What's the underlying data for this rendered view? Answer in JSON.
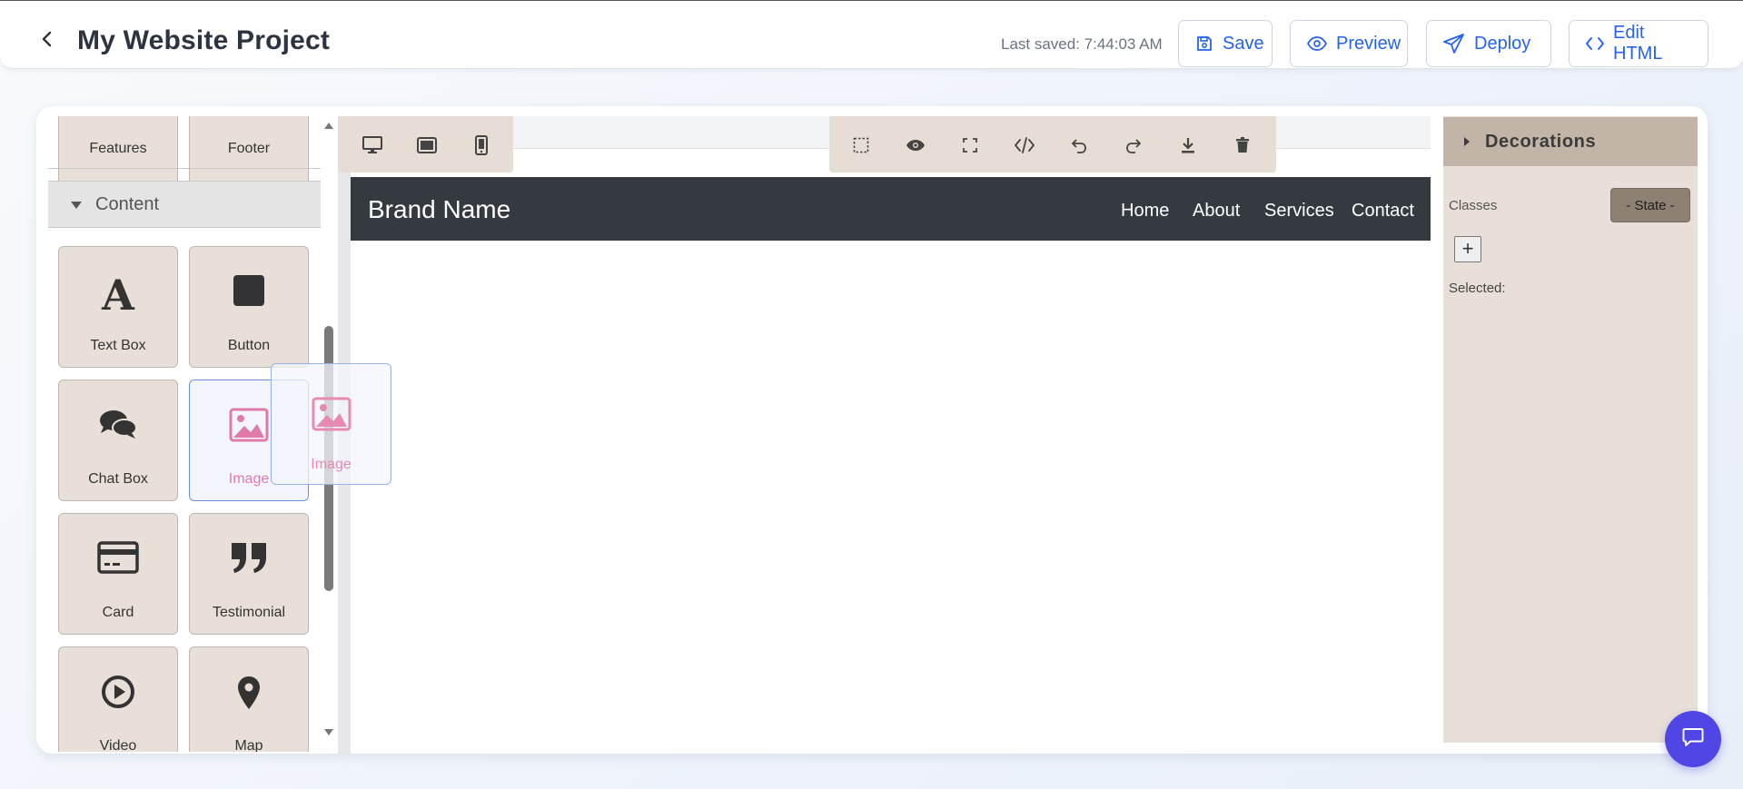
{
  "header": {
    "title": "My Website Project",
    "last_saved": "Last saved: 7:44:03 AM",
    "buttons": {
      "save": "Save",
      "preview": "Preview",
      "deploy": "Deploy",
      "edit_html": "Edit HTML"
    },
    "accent_color": "#2563eb"
  },
  "blocks_panel": {
    "partial_top_items": [
      "Features",
      "Footer"
    ],
    "category": "Content",
    "items": [
      {
        "label": "Text Box",
        "icon": "text-box-icon"
      },
      {
        "label": "Button",
        "icon": "button-square-icon"
      },
      {
        "label": "Chat Box",
        "icon": "chat-bubbles-icon"
      },
      {
        "label": "Image",
        "icon": "image-icon"
      },
      {
        "label": "Card",
        "icon": "credit-card-icon"
      },
      {
        "label": "Testimonial",
        "icon": "quote-icon"
      },
      {
        "label": "Video",
        "icon": "play-circle-icon"
      },
      {
        "label": "Map",
        "icon": "map-pin-icon"
      }
    ],
    "dragging_label": "Image"
  },
  "canvas": {
    "device_buttons": [
      "desktop-icon",
      "tablet-icon",
      "mobile-icon"
    ],
    "toolbar": [
      "select-outline-icon",
      "eye-icon",
      "fullscreen-icon",
      "code-icon",
      "undo-icon",
      "redo-icon",
      "download-icon",
      "trash-icon"
    ],
    "site": {
      "brand": "Brand Name",
      "nav": [
        "Home",
        "About",
        "Services",
        "Contact"
      ],
      "nav_bg": "#343a40"
    }
  },
  "right_panel": {
    "section": "Decorations",
    "classes_label": "Classes",
    "state_select": "- State -",
    "add_label": "+",
    "selected_label": "Selected:"
  }
}
